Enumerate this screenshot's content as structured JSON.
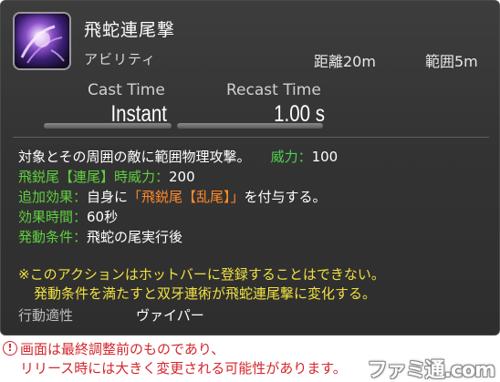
{
  "skill": {
    "name": "飛蛇連尾撃",
    "type": "アビリティ",
    "range": "距離20m",
    "radius": "範囲5m",
    "icon": "serpent-tail-skill-icon"
  },
  "timing": {
    "cast_label": "Cast Time",
    "recast_label": "Recast Time",
    "cast_value": "Instant",
    "recast_value": "1.00 s"
  },
  "description": {
    "line1_text": "対象とその周囲の敵に範囲物理攻撃。",
    "potency_label": "威力",
    "potency_sep": "：",
    "potency_value": "100",
    "line2_label": "飛鋭尾【連尾】時威力：",
    "line2_value": "200",
    "line3_label": "追加効果：",
    "line3_prefix": "自身に",
    "line3_effect": "「飛鋭尾【乱尾】」",
    "line3_suffix": "を付与する。",
    "line4_label": "効果時間：",
    "line4_value": "60秒",
    "line5_label": "発動条件：",
    "line5_value": "飛蛇の尾実行後"
  },
  "notice": {
    "line1": "※このアクションはホットバーに登録することはできない。",
    "line2": "発動条件を満たすと双牙連術が飛蛇連尾撃に変化する。"
  },
  "job": {
    "label": "行動適性",
    "value": "ヴァイパー"
  },
  "disclaimer": {
    "icon": "exclamation-icon",
    "line1": "画面は最終調整前のものであり、",
    "line2": "リリース時には大きく変更される可能性があります。"
  },
  "watermark": "ファミ通.com",
  "colors": {
    "panel_bg": "#333333",
    "effect_label_green": "#5fcf3f",
    "effect_highlight_orange": "#ff8a2a",
    "notice_yellow": "#f0e040",
    "disclaimer_red": "#d4262c"
  }
}
